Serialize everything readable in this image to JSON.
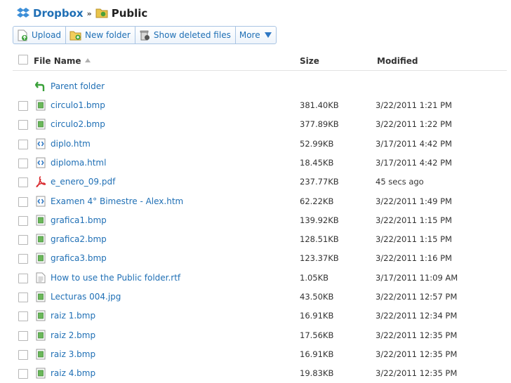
{
  "breadcrumb": {
    "root": "Dropbox",
    "separator": "»",
    "current": "Public"
  },
  "toolbar": {
    "upload": "Upload",
    "new_folder": "New folder",
    "show_deleted": "Show deleted files",
    "more": "More"
  },
  "columns": {
    "name": "File Name",
    "size": "Size",
    "modified": "Modified"
  },
  "parent": {
    "label": "Parent folder"
  },
  "files": [
    {
      "name": "circulo1.bmp",
      "size": "381.40KB",
      "modified": "3/22/2011 1:21 PM",
      "icon": "image-file-icon"
    },
    {
      "name": "circulo2.bmp",
      "size": "377.89KB",
      "modified": "3/22/2011 1:22 PM",
      "icon": "image-file-icon"
    },
    {
      "name": "diplo.htm",
      "size": "52.99KB",
      "modified": "3/17/2011 4:42 PM",
      "icon": "html-file-icon"
    },
    {
      "name": "diploma.html",
      "size": "18.45KB",
      "modified": "3/17/2011 4:42 PM",
      "icon": "html-file-icon"
    },
    {
      "name": "e_enero_09.pdf",
      "size": "237.77KB",
      "modified": "45 secs ago",
      "icon": "pdf-file-icon"
    },
    {
      "name": "Examen 4° Bimestre - Alex.htm",
      "size": "62.22KB",
      "modified": "3/22/2011 1:49 PM",
      "icon": "html-file-icon"
    },
    {
      "name": "grafica1.bmp",
      "size": "139.92KB",
      "modified": "3/22/2011 1:15 PM",
      "icon": "image-file-icon"
    },
    {
      "name": "grafica2.bmp",
      "size": "128.51KB",
      "modified": "3/22/2011 1:15 PM",
      "icon": "image-file-icon"
    },
    {
      "name": "grafica3.bmp",
      "size": "123.37KB",
      "modified": "3/22/2011 1:16 PM",
      "icon": "image-file-icon"
    },
    {
      "name": "How to use the Public folder.rtf",
      "size": "1.05KB",
      "modified": "3/17/2011 11:09 AM",
      "icon": "document-file-icon"
    },
    {
      "name": "Lecturas 004.jpg",
      "size": "43.50KB",
      "modified": "3/22/2011 12:57 PM",
      "icon": "image-file-icon"
    },
    {
      "name": "raiz 1.bmp",
      "size": "16.91KB",
      "modified": "3/22/2011 12:34 PM",
      "icon": "image-file-icon"
    },
    {
      "name": "raiz 2.bmp",
      "size": "17.56KB",
      "modified": "3/22/2011 12:35 PM",
      "icon": "image-file-icon"
    },
    {
      "name": "raiz 3.bmp",
      "size": "16.91KB",
      "modified": "3/22/2011 12:35 PM",
      "icon": "image-file-icon"
    },
    {
      "name": "raiz 4.bmp",
      "size": "19.83KB",
      "modified": "3/22/2011 12:35 PM",
      "icon": "image-file-icon"
    }
  ],
  "colors": {
    "link": "#1f6fb5",
    "button_border": "#a9c4e3",
    "parent_arrow": "#3aa13a",
    "pdf_red": "#d9262b"
  }
}
